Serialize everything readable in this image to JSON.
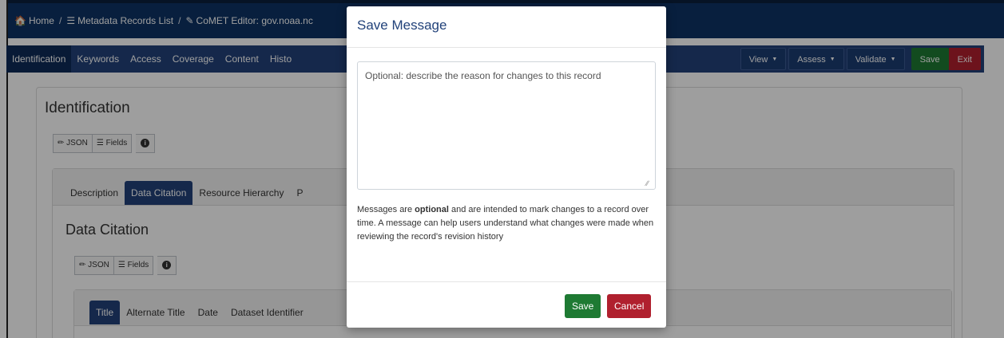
{
  "breadcrumb": {
    "home": "Home",
    "records": "Metadata Records List",
    "editor": "CoMET Editor: gov.noaa.nc"
  },
  "navbar": {
    "tabs": [
      "Identification",
      "Keywords",
      "Access",
      "Coverage",
      "Content",
      "Histo"
    ],
    "view": "View",
    "assess": "Assess",
    "validate": "Validate",
    "save": "Save",
    "exit": "Exit"
  },
  "identification": {
    "title": "Identification",
    "json_btn": "JSON",
    "fields_btn": "Fields"
  },
  "subtabs": [
    "Description",
    "Data Citation",
    "Resource Hierarchy",
    "P"
  ],
  "data_citation": {
    "title": "Data Citation",
    "json_btn": "JSON",
    "fields_btn": "Fields",
    "tabs": [
      "Title",
      "Alternate Title",
      "Date",
      "Dataset Identifier"
    ]
  },
  "modal": {
    "title": "Save Message",
    "placeholder": "Optional: describe the reason for changes to this record",
    "help_before": "Messages are ",
    "help_bold": "optional",
    "help_after": " and are intended to mark changes to a record over time. A message can help users understand what changes were made when reviewing the record's revision history",
    "save": "Save",
    "cancel": "Cancel"
  },
  "colors": {
    "navy": "#0d3364",
    "nav_blue": "#22427a",
    "save_green": "#1e7a33",
    "cancel_red": "#b0202e"
  },
  "icons": [
    "home-icon",
    "list-icon",
    "edit-icon",
    "pencil-icon",
    "info-icon",
    "caret-down-icon"
  ]
}
